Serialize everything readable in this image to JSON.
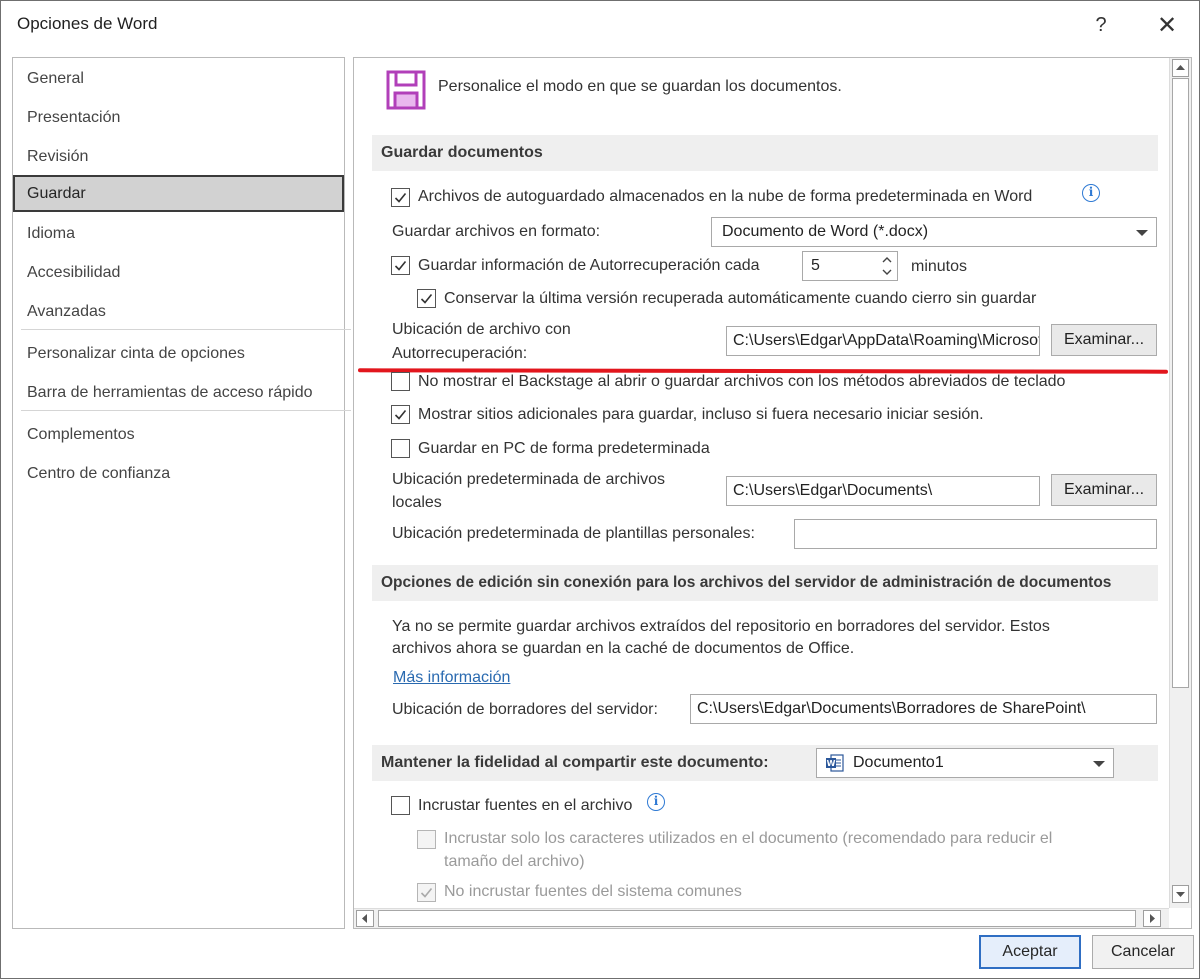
{
  "window": {
    "title": "Opciones de Word",
    "help_glyph": "?",
    "close_glyph": "✕"
  },
  "nav": {
    "items": [
      "General",
      "Presentación",
      "Revisión",
      "Guardar",
      "Idioma",
      "Accesibilidad",
      "Avanzadas",
      "Personalizar cinta de opciones",
      "Barra de herramientas de acceso rápido",
      "Complementos",
      "Centro de confianza"
    ],
    "selected": "Guardar"
  },
  "header": {
    "icon": "save-floppy-icon",
    "title": "Personalice el modo en que se guardan los documentos."
  },
  "save_docs": {
    "section_title": "Guardar documentos",
    "autosave_cloud": {
      "label": "Archivos de autoguardado almacenados en la nube de forma predeterminada en Word",
      "checked": true
    },
    "format_label": "Guardar archivos en formato:",
    "format_value": "Documento de Word (*.docx)",
    "autorecover": {
      "label": "Guardar información de Autorrecuperación cada",
      "checked": true,
      "minutes": "5",
      "unit": "minutos"
    },
    "keep_last": {
      "label": "Conservar la última versión recuperada automáticamente cuando cierro sin guardar",
      "checked": true
    },
    "autorecover_location_label_1": "Ubicación de archivo con",
    "autorecover_location_label_2": "Autorrecuperación:",
    "autorecover_location_value": "C:\\Users\\Edgar\\AppData\\Roaming\\Microsoft\\Word\\",
    "browse_label": "Examinar...",
    "no_backstage": {
      "label": "No mostrar el Backstage al abrir o guardar archivos con los métodos abreviados de teclado",
      "checked": false
    },
    "show_additional": {
      "label": "Mostrar sitios adicionales para guardar, incluso si fuera necesario iniciar sesión.",
      "checked": true
    },
    "save_pc": {
      "label": "Guardar en PC de forma predeterminada",
      "checked": false
    },
    "local_location_label_1": "Ubicación predeterminada de archivos",
    "local_location_label_2": "locales",
    "local_location_value": "C:\\Users\\Edgar\\Documents\\",
    "templates_label": "Ubicación predeterminada de plantillas personales:",
    "templates_value": ""
  },
  "offline": {
    "section_title": "Opciones de edición sin conexión para los archivos del servidor de administración de documentos",
    "desc_1": "Ya no se permite guardar archivos extraídos del repositorio en borradores del servidor. Estos",
    "desc_2": "archivos ahora se guardan en la caché de documentos de Office.",
    "more_info": "Más información",
    "drafts_label": "Ubicación de borradores del servidor:",
    "drafts_value": "C:\\Users\\Edgar\\Documents\\Borradores de SharePoint\\"
  },
  "fidelity": {
    "section_title": "Mantener la fidelidad al compartir este documento:",
    "document": "Documento1",
    "embed_fonts": {
      "label": "Incrustar fuentes en el archivo",
      "checked": false
    },
    "embed_used_1": "Incrustar solo los caracteres utilizados en el documento (recomendado para reducir el",
    "embed_used_2": "tamaño del archivo)",
    "no_common": "No incrustar fuentes del sistema comunes"
  },
  "footer": {
    "ok": "Aceptar",
    "cancel": "Cancelar"
  },
  "colors": {
    "accent": "#2f6ec3",
    "link": "#2a6ab0",
    "annotation_red": "#e2161d",
    "save_icon": "#b13fb9"
  }
}
